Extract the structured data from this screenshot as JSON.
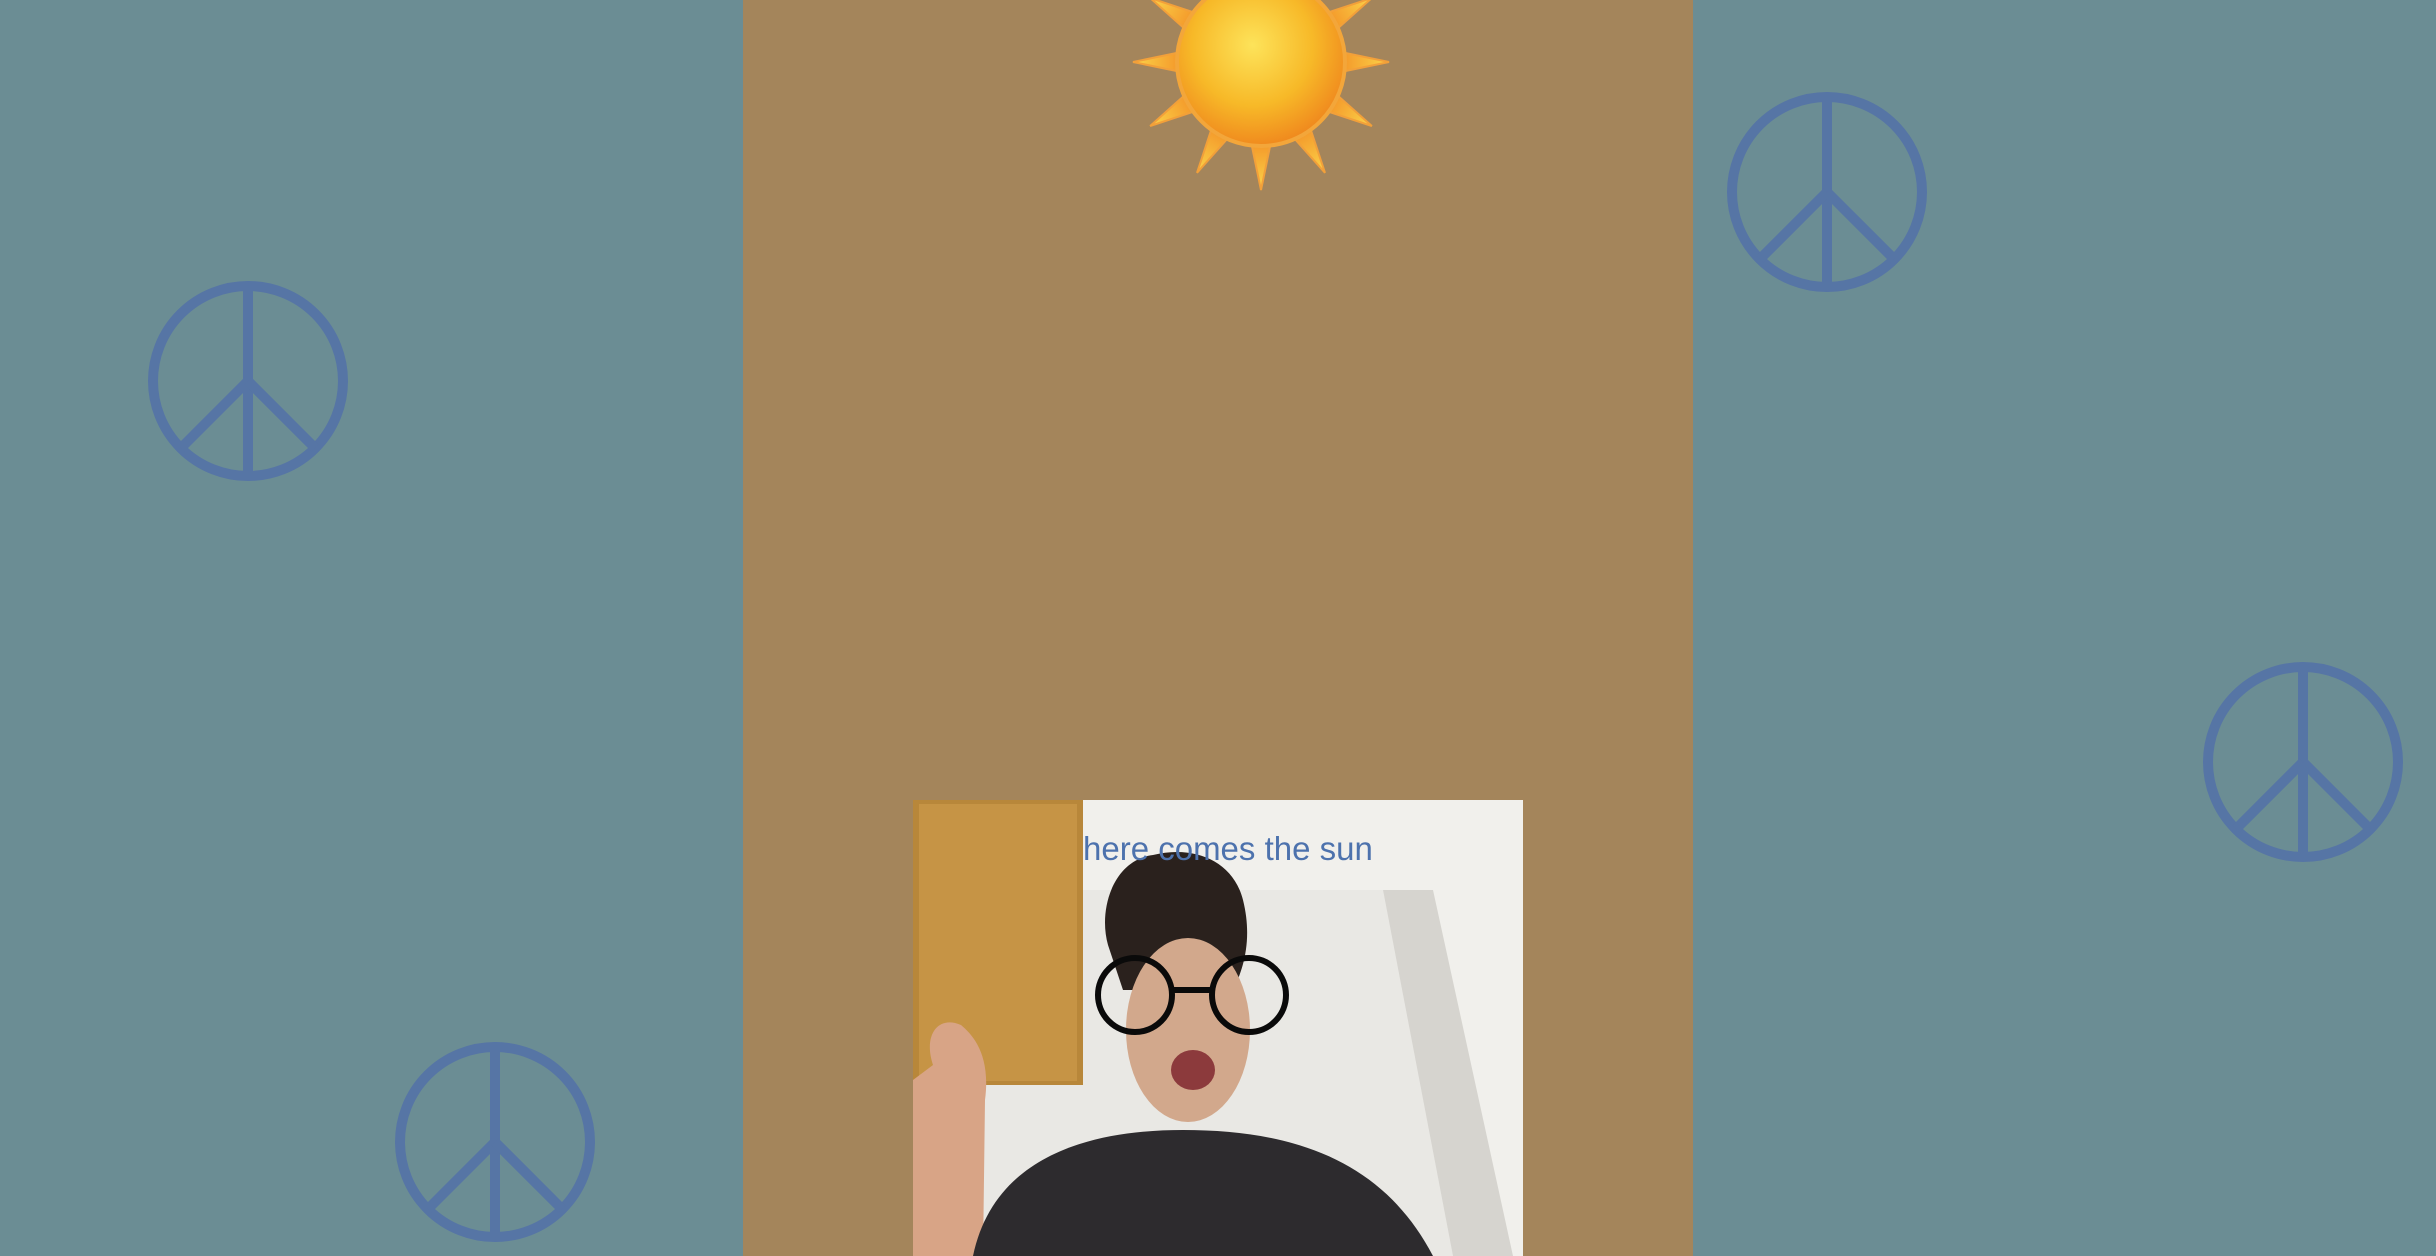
{
  "caption": "here comes the sun",
  "colors": {
    "side_background": "#6b8d94",
    "center_background": "#a4855b",
    "peace_symbol": "#5675a5",
    "caption_text": "#4d72ad",
    "sun_core": "#f7b928",
    "sun_rays": "#f59a2a"
  },
  "decorations": {
    "peace_symbols_count": 4,
    "sun_icon": "sun-icon",
    "peace_icon": "peace-sign-icon",
    "glasses_overlay": "round-glasses-icon"
  },
  "webcam": {
    "description_visible": "webcam-feed"
  }
}
